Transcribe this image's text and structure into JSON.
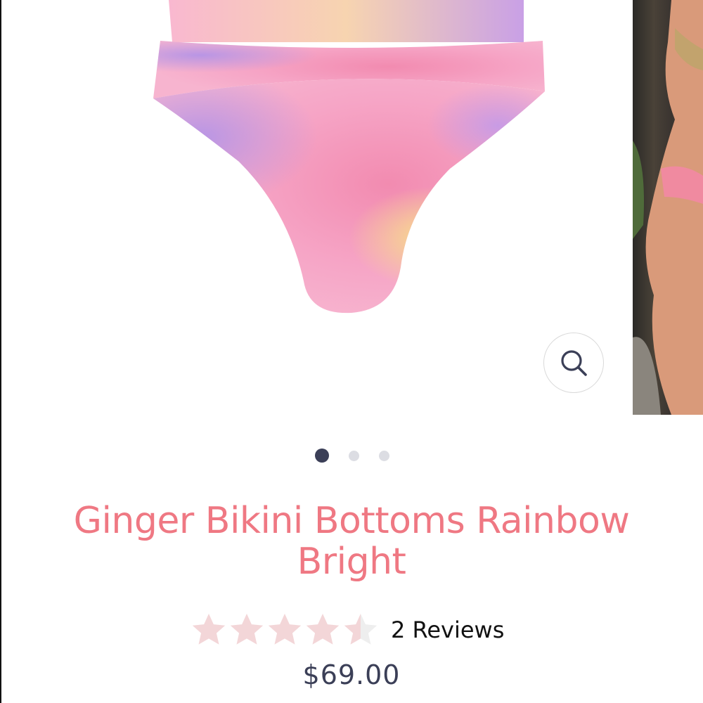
{
  "product": {
    "title": "Ginger Bikini Bottoms Rainbow Bright",
    "reviews_label": "2 Reviews",
    "rating": 4.5,
    "rating_max": 5,
    "price": "$69.00"
  },
  "gallery": {
    "image_count": 3,
    "active_index": 0
  },
  "icons": {
    "zoom": "search-icon",
    "star": "star-icon"
  },
  "colors": {
    "title": "#ef7883",
    "price": "#3b3f57",
    "dot_active": "#3b3f57",
    "dot_inactive": "#dcdde3",
    "star_filled": "#f3d6d8",
    "star_empty": "#eeeeee"
  }
}
